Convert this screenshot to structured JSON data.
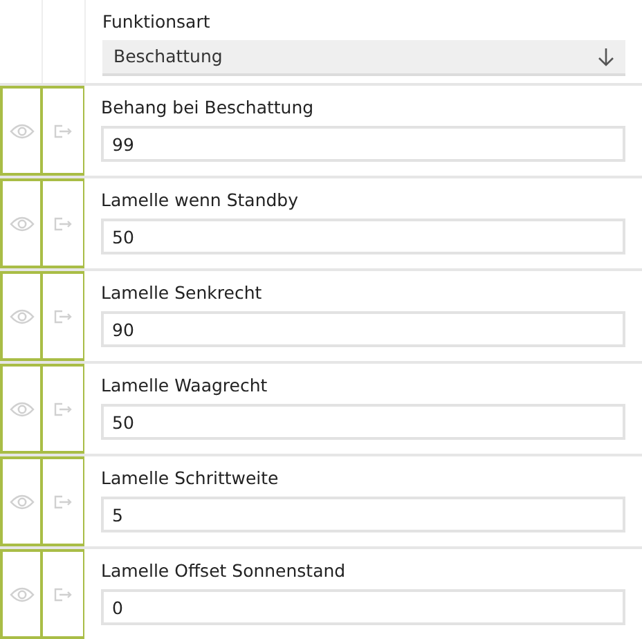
{
  "function_select": {
    "label": "Funktionsart",
    "value": "Beschattung"
  },
  "fields": [
    {
      "label": "Behang bei Beschattung",
      "value": "99"
    },
    {
      "label": "Lamelle wenn Standby",
      "value": "50"
    },
    {
      "label": "Lamelle Senkrecht",
      "value": "90"
    },
    {
      "label": "Lamelle Waagrecht",
      "value": "50"
    },
    {
      "label": "Lamelle Schrittweite",
      "value": "5"
    },
    {
      "label": "Lamelle Offset Sonnenstand",
      "value": "0"
    }
  ]
}
